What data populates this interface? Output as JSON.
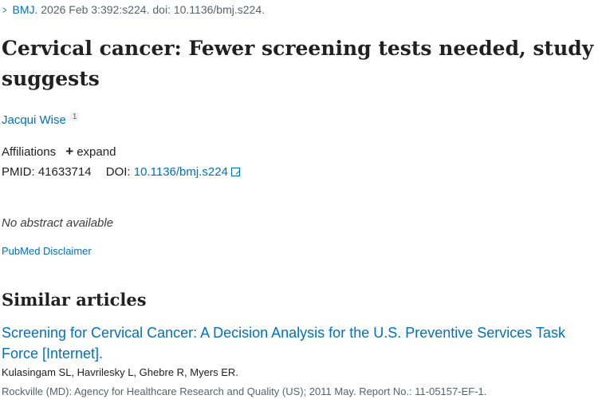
{
  "citation": {
    "journal": "BMJ",
    "details": ". 2026 Feb 3:392:s224. doi: 10.1136/bmj.s224."
  },
  "title": "Cervical cancer: Fewer screening tests needed, study suggests",
  "author": {
    "name": "Jacqui Wise",
    "affiliation_ref": "1"
  },
  "affiliations": {
    "label": "Affiliations",
    "expand_label": "expand"
  },
  "ids": {
    "pmid_label": "PMID:",
    "pmid": "41633714",
    "doi_label": "DOI:",
    "doi": "10.1136/bmj.s224"
  },
  "abstract_note": "No abstract available",
  "disclaimer": "PubMed Disclaimer",
  "similar_articles": {
    "heading": "Similar articles",
    "items": [
      {
        "title": "Screening for Cervical Cancer: A Decision Analysis for the U.S. Preventive Services Task Force [Internet].",
        "authors": "Kulasingam SL, Havrilesky L, Ghebre R, Myers ER.",
        "source": "Rockville (MD): Agency for Healthcare Research and Quality (US); 2011 May. Report No.: 11-05157-EF-1."
      }
    ]
  },
  "colors": {
    "link": "#0071bc",
    "text": "#212121",
    "muted": "#5b616b"
  },
  "icons": [
    "chevron-right-icon",
    "plus-icon",
    "external-link-icon"
  ]
}
